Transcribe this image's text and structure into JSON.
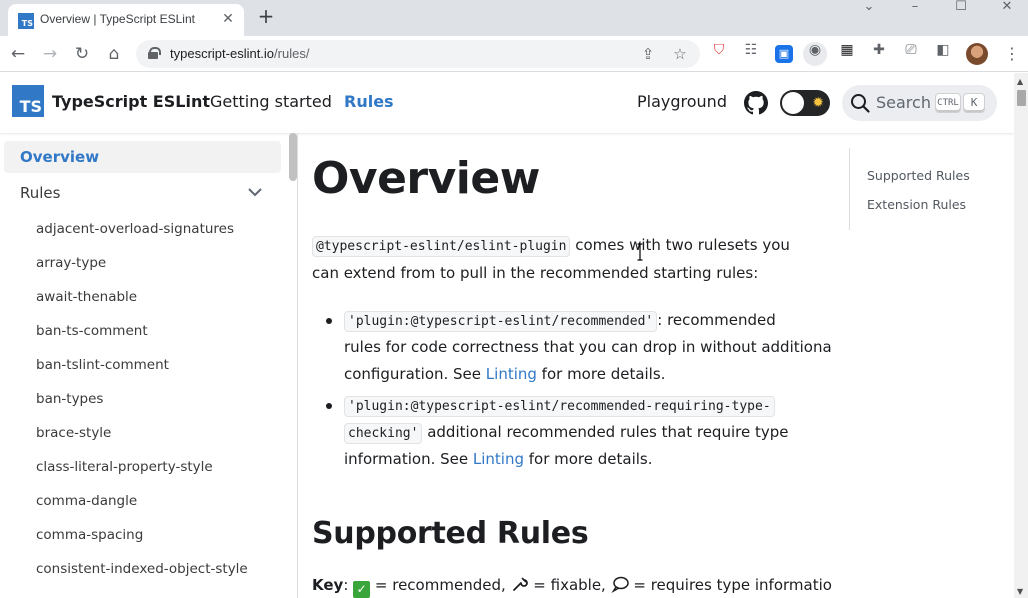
{
  "browser": {
    "tab_title": "Overview | TypeScript ESLint",
    "tab_favicon_text": "TS",
    "tab_close": "✕",
    "new_tab": "+",
    "url_host": "typescript-eslint.io",
    "url_path": "/rules/",
    "icons": [
      "back-icon",
      "forward-icon",
      "reload-icon",
      "home-icon",
      "lock-icon",
      "share-icon",
      "bookmark-star-icon",
      "pocket-icon",
      "extension-icon",
      "puzzle-icon",
      "cast-icon",
      "side-panel-icon",
      "profile-avatar",
      "kebab-menu-icon"
    ]
  },
  "site": {
    "logo_text": "TS",
    "brand": "TypeScript ESLint",
    "nav": {
      "getting_started": "Getting started",
      "rules": "Rules",
      "playground": "Playground"
    },
    "search": {
      "label": "Search",
      "kbd_ctrl": "CTRL",
      "kbd_k": "K"
    },
    "colors": {
      "accent": "#3178c6",
      "text": "#1c1e21"
    }
  },
  "sidebar": {
    "overview": "Overview",
    "rules_label": "Rules",
    "items": [
      "adjacent-overload-signatures",
      "array-type",
      "await-thenable",
      "ban-ts-comment",
      "ban-tslint-comment",
      "ban-types",
      "brace-style",
      "class-literal-property-style",
      "comma-dangle",
      "comma-spacing",
      "consistent-indexed-object-style"
    ]
  },
  "main": {
    "title": "Overview",
    "intro": {
      "code": "@typescript-eslint/eslint-plugin",
      "text1": " comes with two rulesets you",
      "text2": "can extend from to pull in the recommended starting rules:"
    },
    "bullet1": {
      "code": "'plugin:@typescript-eslint/recommended'",
      "text1": ": recommended",
      "text2": "rules for code correctness that you can drop in without additional",
      "text3_pre": "configuration. See ",
      "link": "Linting",
      "text3_post": " for more details."
    },
    "bullet2": {
      "code_line1": "'plugin:@typescript-eslint/recommended-requiring-type-",
      "code_line2": "checking'",
      "text2": " additional recommended rules that require type",
      "text3_pre": "information. See ",
      "link": "Linting",
      "text3_post": " for more details."
    },
    "supported_heading": "Supported Rules",
    "key": {
      "label": "Key",
      "colon": ": ",
      "check": "✓",
      "recommended": " = recommended, ",
      "fixable": " = fixable, ",
      "type_info": " = requires type information"
    }
  },
  "toc": {
    "items": [
      "Supported Rules",
      "Extension Rules"
    ]
  }
}
